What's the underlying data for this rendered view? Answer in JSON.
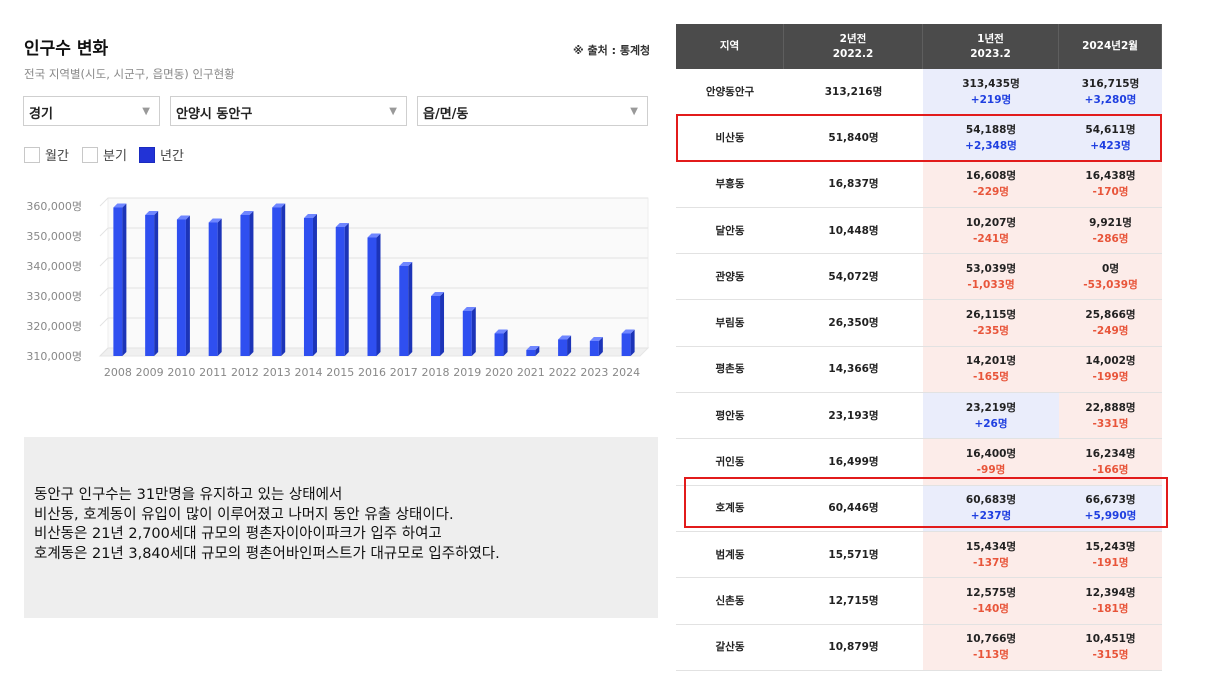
{
  "header": {
    "title": "인구수 변화",
    "subtitle": "전국 지역별(시도, 시군구, 읍면동) 인구현황",
    "source": "※ 출처 : 통계청"
  },
  "filters": {
    "province": "경기",
    "city": "안양시 동안구",
    "town": "읍/면/동",
    "arrow": "▼"
  },
  "periods": [
    {
      "label": "월간",
      "checked": false
    },
    {
      "label": "분기",
      "checked": false
    },
    {
      "label": "년간",
      "checked": true
    }
  ],
  "chart_data": {
    "type": "bar",
    "categories": [
      "2008",
      "2009",
      "2010",
      "2011",
      "2012",
      "2013",
      "2014",
      "2015",
      "2016",
      "2017",
      "2018",
      "2019",
      "2020",
      "2021",
      "2022",
      "2023",
      "2024"
    ],
    "values": [
      359500,
      357000,
      355500,
      354500,
      357000,
      359500,
      356000,
      353000,
      349500,
      340000,
      330000,
      325000,
      317500,
      312000,
      315500,
      315000,
      317500
    ],
    "yticks": [
      310000,
      320000,
      330000,
      340000,
      350000,
      360000
    ],
    "ytick_labels": [
      "310,000명",
      "320,000명",
      "330,000명",
      "340,000명",
      "350,000명",
      "360,000명"
    ],
    "ylim": [
      310000,
      360000
    ],
    "bar_color": "#2f4ff0",
    "grid": true
  },
  "note": {
    "lines": [
      "동안구 인구수는 31만명을 유지하고 있는 상태에서",
      "비산동, 호계동이 유입이 많이 이루어졌고 나머지 동안 유출 상태이다.",
      "비산동은 21년 2,700세대 규모의 평촌자이아이파크가 입주 하여고",
      "호계동은 21년 3,840세대 규모의 평촌어바인퍼스트가 대규모로 입주하였다."
    ]
  },
  "table": {
    "headers": [
      {
        "line1": "지역",
        "line2": ""
      },
      {
        "line1": "2년전",
        "line2": "2022.2"
      },
      {
        "line1": "1년전",
        "line2": "2023.2"
      },
      {
        "line1": "2024년2월",
        "line2": ""
      }
    ],
    "rows": [
      {
        "region": "안양동안구",
        "y2": "313,216명",
        "y1": "313,435명",
        "y1d": "+219명",
        "y1t": "up",
        "y0": "316,715명",
        "y0d": "+3,280명",
        "y0t": "up"
      },
      {
        "region": "비산동",
        "y2": "51,840명",
        "y1": "54,188명",
        "y1d": "+2,348명",
        "y1t": "up",
        "y0": "54,611명",
        "y0d": "+423명",
        "y0t": "up"
      },
      {
        "region": "부흥동",
        "y2": "16,837명",
        "y1": "16,608명",
        "y1d": "-229명",
        "y1t": "down",
        "y0": "16,438명",
        "y0d": "-170명",
        "y0t": "down"
      },
      {
        "region": "달안동",
        "y2": "10,448명",
        "y1": "10,207명",
        "y1d": "-241명",
        "y1t": "down",
        "y0": "9,921명",
        "y0d": "-286명",
        "y0t": "down"
      },
      {
        "region": "관양동",
        "y2": "54,072명",
        "y1": "53,039명",
        "y1d": "-1,033명",
        "y1t": "down",
        "y0": "0명",
        "y0d": "-53,039명",
        "y0t": "down"
      },
      {
        "region": "부림동",
        "y2": "26,350명",
        "y1": "26,115명",
        "y1d": "-235명",
        "y1t": "down",
        "y0": "25,866명",
        "y0d": "-249명",
        "y0t": "down"
      },
      {
        "region": "평촌동",
        "y2": "14,366명",
        "y1": "14,201명",
        "y1d": "-165명",
        "y1t": "down",
        "y0": "14,002명",
        "y0d": "-199명",
        "y0t": "down"
      },
      {
        "region": "평안동",
        "y2": "23,193명",
        "y1": "23,219명",
        "y1d": "+26명",
        "y1t": "up",
        "y0": "22,888명",
        "y0d": "-331명",
        "y0t": "down"
      },
      {
        "region": "귀인동",
        "y2": "16,499명",
        "y1": "16,400명",
        "y1d": "-99명",
        "y1t": "down",
        "y0": "16,234명",
        "y0d": "-166명",
        "y0t": "down"
      },
      {
        "region": "호계동",
        "y2": "60,446명",
        "y1": "60,683명",
        "y1d": "+237명",
        "y1t": "up",
        "y0": "66,673명",
        "y0d": "+5,990명",
        "y0t": "up"
      },
      {
        "region": "범계동",
        "y2": "15,571명",
        "y1": "15,434명",
        "y1d": "-137명",
        "y1t": "down",
        "y0": "15,243명",
        "y0d": "-191명",
        "y0t": "down"
      },
      {
        "region": "신촌동",
        "y2": "12,715명",
        "y1": "12,575명",
        "y1d": "-140명",
        "y1t": "down",
        "y0": "12,394명",
        "y0d": "-181명",
        "y0t": "down"
      },
      {
        "region": "갈산동",
        "y2": "10,879명",
        "y1": "10,766명",
        "y1d": "-113명",
        "y1t": "down",
        "y0": "10,451명",
        "y0d": "-315명",
        "y0t": "down"
      }
    ],
    "highlight_color": "#e21b1b"
  }
}
